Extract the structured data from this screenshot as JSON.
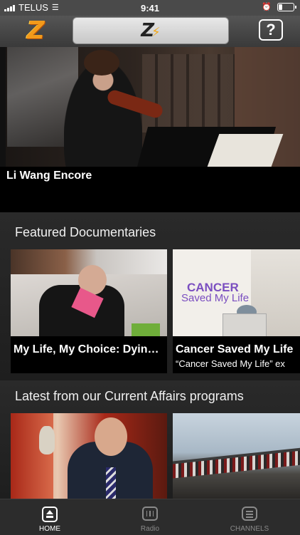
{
  "status_bar": {
    "carrier": "TELUS",
    "time": "9:41",
    "battery_level": 0.3
  },
  "nav": {
    "logo_text": "Z",
    "search_logo_text": "Z",
    "help_label": "?"
  },
  "hero": {
    "title": "Li Wang Encore"
  },
  "sections": {
    "documentaries": {
      "title": "Featured Documentaries",
      "cards": [
        {
          "title": "My Life, My Choice: Dyin…",
          "subtitle": ""
        },
        {
          "title": "Cancer Saved My Life",
          "subtitle": "“Cancer Saved My Life” ex",
          "art_line1": "CANCER",
          "art_line2": "Saved My Life"
        }
      ]
    },
    "current_affairs": {
      "title": "Latest from our Current Affairs programs"
    }
  },
  "tabs": [
    {
      "label": "HOME",
      "icon": "home-icon",
      "active": true
    },
    {
      "label": "Radio",
      "icon": "radio-icon",
      "active": false
    },
    {
      "label": "CHANNELS",
      "icon": "channels-icon",
      "active": false
    }
  ],
  "colors": {
    "accent": "#f39a1a",
    "active_tab": "#ffffff",
    "inactive_tab": "#8a8a8a"
  }
}
